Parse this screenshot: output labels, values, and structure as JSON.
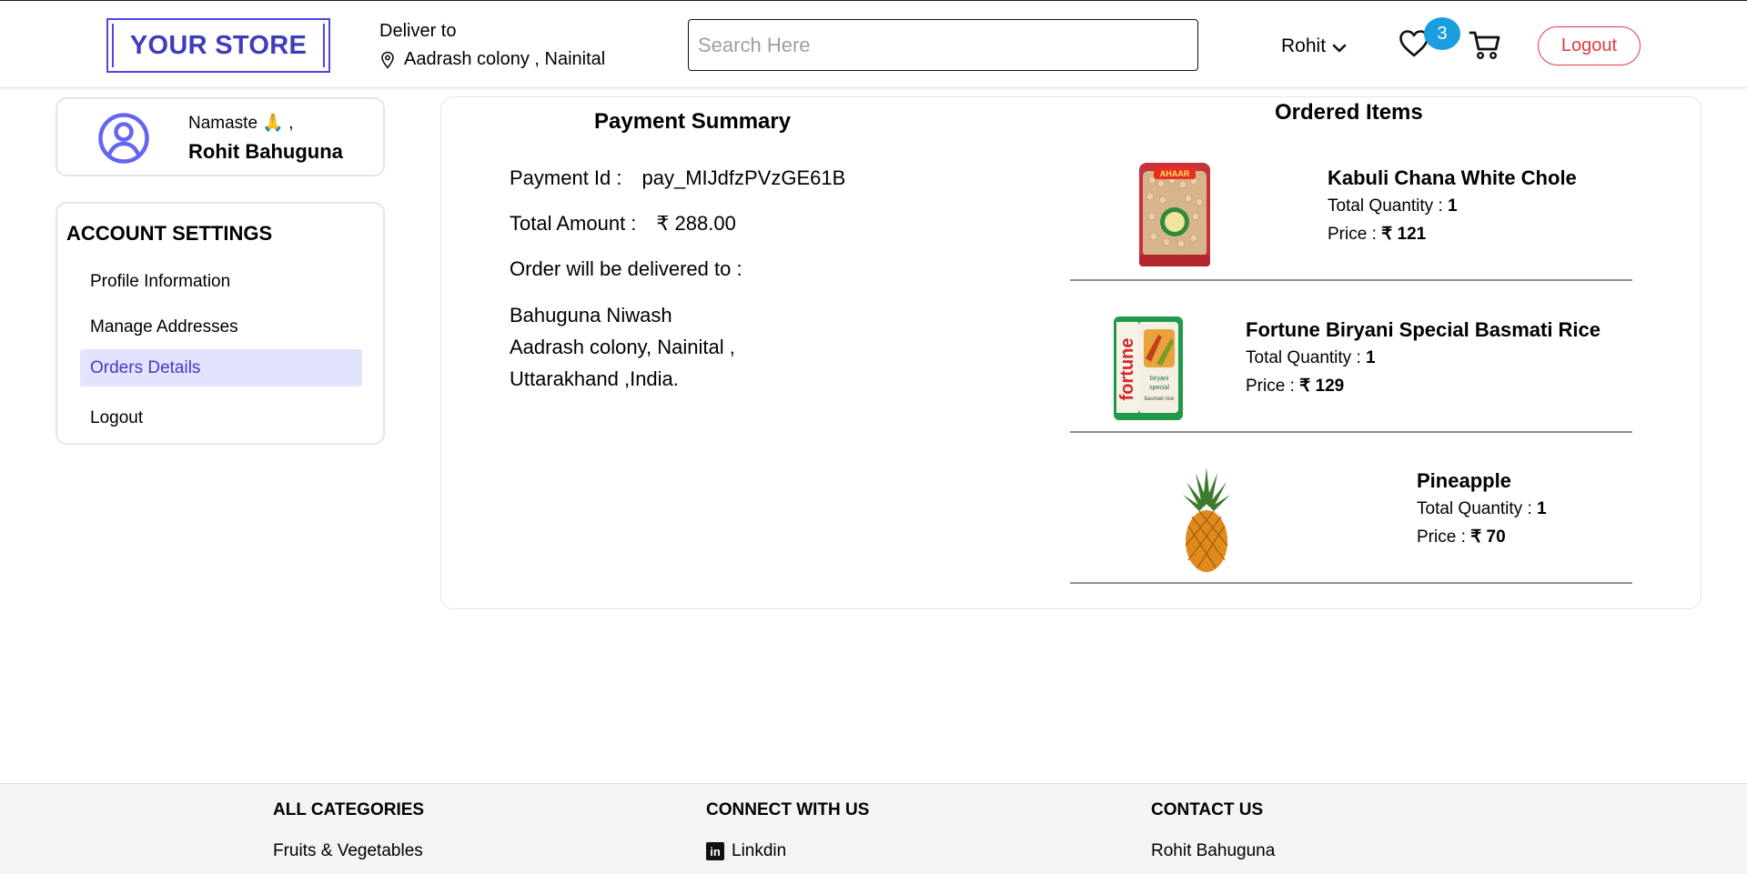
{
  "header": {
    "logo_text": "YOUR STORE",
    "deliver_label": "Deliver to",
    "deliver_location": "Aadrash colony , Nainital",
    "search_placeholder": "Search Here",
    "user_name": "Rohit",
    "wishlist_count": "3",
    "logout_label": "Logout",
    "icons": [
      "location-pin-icon",
      "chevron-down-icon",
      "heart-icon",
      "cart-icon"
    ]
  },
  "profile": {
    "greeting": "Namaste 🙏 ,",
    "name": "Rohit Bahuguna",
    "icon": "user-avatar-icon"
  },
  "sidebar": {
    "title": "ACCOUNT SETTINGS",
    "items": [
      {
        "label": "Profile Information",
        "active": false
      },
      {
        "label": "Manage Addresses",
        "active": false
      },
      {
        "label": "Orders Details",
        "active": true
      },
      {
        "label": "Logout",
        "active": false
      }
    ]
  },
  "payment": {
    "title": "Payment Summary",
    "id_label": "Payment Id :",
    "id_value": "pay_MIJdfzPVzGE61B",
    "amount_label": "Total Amount :",
    "amount_value": "₹ 288.00",
    "delivery_label": "Order will be delivered to :",
    "address": [
      "Bahuguna Niwash",
      "Aadrash colony, Nainital ,",
      "Uttarakhand ,India."
    ]
  },
  "ordered": {
    "title": "Ordered Items",
    "qty_label": "Total Quantity :",
    "price_label": "Price :",
    "items": [
      {
        "name": "Kabuli Chana White Chole",
        "quantity": "1",
        "price": "₹ 121",
        "image": "chickpea-pack-image"
      },
      {
        "name": "Fortune Biryani Special Basmati Rice",
        "quantity": "1",
        "price": "₹ 129",
        "image": "rice-pack-image"
      },
      {
        "name": "Pineapple",
        "quantity": "1",
        "price": "₹ 70",
        "image": "pineapple-image"
      }
    ]
  },
  "footer": {
    "categories_title": "ALL CATEGORIES",
    "categories_first": "Fruits & Vegetables",
    "connect_title": "CONNECT WITH US",
    "connect_first": "Linkdin",
    "contact_title": "CONTACT US",
    "contact_first": "Rohit Bahuguna"
  },
  "colors": {
    "brand": "#4f46e5",
    "badge": "#1a9ee0",
    "logout": "#e53945",
    "active_bg": "#e1e4fc"
  }
}
